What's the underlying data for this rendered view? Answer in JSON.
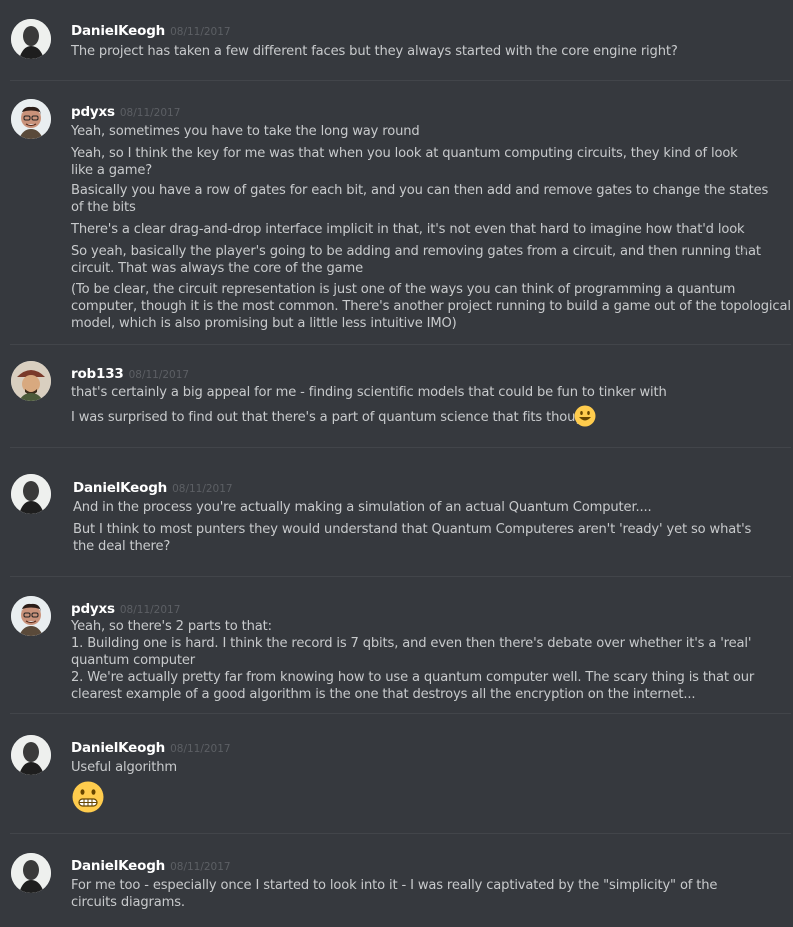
{
  "messages": [
    {
      "author": "DanielKeogh",
      "timestamp": "08/11/2017",
      "lines": [
        [
          "The project has taken a few different faces but they always started with the core engine right?"
        ]
      ]
    },
    {
      "author": "pdyxs",
      "timestamp": "08/11/2017",
      "lines": [
        [
          "Yeah, sometimes you have to take the long way round"
        ],
        [
          "Yeah, so I think the key for me was that when you look at quantum computing circuits, they kind of look",
          "like a game?"
        ],
        [
          "Basically you have a row of gates for each bit, and you can then add and remove gates to change the states",
          "of the bits"
        ],
        [
          "There's a clear drag-and-drop interface implicit in that, it's not even that hard to imagine how that'd look"
        ],
        [
          "So yeah, basically the player's going to be adding and removing gates from a circuit, and then running that",
          "circuit. That was always the core of the game"
        ],
        [
          "(To be clear, the circuit representation is just one of the ways you can think of programming a quantum",
          "computer, though it is the most common. There's another project running to build a game out of the topological",
          "model, which is also promising but a little less intuitive IMO)"
        ]
      ]
    },
    {
      "author": "rob133",
      "timestamp": "08/11/2017",
      "lines": [
        [
          "that's certainly a big appeal for me - finding scientific models that could be fun to tinker with"
        ],
        [
          "I was surprised to find out that there's a part of quantum science that fits though"
        ]
      ],
      "inline_emoji": "grinning-smiley"
    },
    {
      "author": "DanielKeogh",
      "timestamp": "08/11/2017",
      "lines": [
        [
          "And in the process you're actually making a simulation of an actual Quantum Computer...."
        ],
        [
          "But I think to most punters they would understand that Quantum Computeres aren't 'ready' yet so what's",
          "the deal there?"
        ]
      ]
    },
    {
      "author": "pdyxs",
      "timestamp": "08/11/2017",
      "lines": [
        [
          "Yeah, so there's 2 parts to that:",
          "1. Building one is hard. I think the record is 7 qbits, and even then there's debate over whether it's a 'real'",
          "quantum computer",
          "2. We're actually pretty far from knowing how to use a quantum computer well. The scary thing is that our",
          "clearest example of a good algorithm is the one that destroys all the encryption on the internet..."
        ]
      ]
    },
    {
      "author": "DanielKeogh",
      "timestamp": "08/11/2017",
      "lines": [
        [
          "Useful algorithm"
        ]
      ],
      "big_emoji": "grimacing-face"
    },
    {
      "author": "DanielKeogh",
      "timestamp": "08/11/2017",
      "lines": [
        [
          "For me too - especially once I started to look into it - I was really captivated by the \"simplicity\" of the",
          "circuits diagrams."
        ]
      ]
    }
  ],
  "colors": {
    "background": "#36393e",
    "username": "#ffffff",
    "text": "#c8cacc",
    "timestamp": "#5c5f64",
    "divider": "#42454a",
    "emoji_yellow": "#ffcc4d"
  },
  "icons": {
    "hover_actions": "reaction-and-more-icons"
  }
}
